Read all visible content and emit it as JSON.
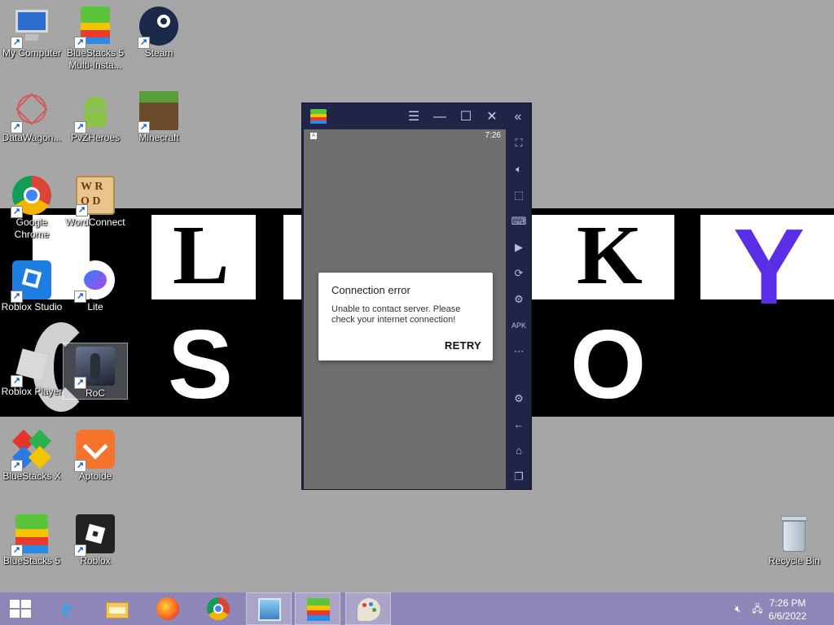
{
  "desktop": {
    "icons": [
      {
        "label": "My Computer",
        "icon": "computer-icon"
      },
      {
        "label": "BlueStacks 5 Multi-Insta...",
        "icon": "bluestacks-multi-icon"
      },
      {
        "label": "Steam",
        "icon": "steam-icon"
      },
      {
        "label": "DataWagon...",
        "icon": "datawagon-icon"
      },
      {
        "label": "PvZHeroes",
        "icon": "android-icon"
      },
      {
        "label": "Minecraft",
        "icon": "minecraft-icon"
      },
      {
        "label": "Google Chrome",
        "icon": "chrome-icon"
      },
      {
        "label": "WordConnect",
        "icon": "wordconnect-icon"
      },
      {
        "label": "Roblox Studio",
        "icon": "roblox-studio-icon"
      },
      {
        "label": "Lite",
        "icon": "messenger-lite-icon"
      },
      {
        "label": "Roblox Player",
        "icon": "roblox-player-icon"
      },
      {
        "label": "RoC",
        "icon": "roc-icon"
      },
      {
        "label": "BlueStacks X",
        "icon": "bluestacks-x-icon"
      },
      {
        "label": "Aptoide",
        "icon": "aptoide-icon"
      },
      {
        "label": "BlueStacks 5",
        "icon": "bluestacks-icon"
      },
      {
        "label": "Roblox",
        "icon": "roblox-icon"
      },
      {
        "label": "Recycle Bin",
        "icon": "recycle-bin-icon"
      }
    ],
    "wallpaper_letters": {
      "row1": [
        "L",
        "K",
        "Y"
      ],
      "row2": [
        "S",
        "O"
      ]
    }
  },
  "bluestacks": {
    "status_time": "7:26",
    "status_icon": "A",
    "dialog": {
      "title": "Connection error",
      "message": "Unable to contact server. Please check your internet connection!",
      "retry_label": "RETRY"
    }
  },
  "taskbar": {
    "items": [
      "start-icon",
      "internet-explorer-icon",
      "file-explorer-icon",
      "firefox-icon",
      "chrome-icon",
      "photos-icon",
      "bluestacks-icon",
      "paint-icon"
    ],
    "clock_time": "7:26 PM",
    "clock_date": "6/6/2022"
  },
  "colors": {
    "desktop_bg": "#a6a6a6",
    "bluestacks_frame": "#202547",
    "taskbar": "#8d86b6",
    "wallpaper_y": "#5a2ee6"
  }
}
